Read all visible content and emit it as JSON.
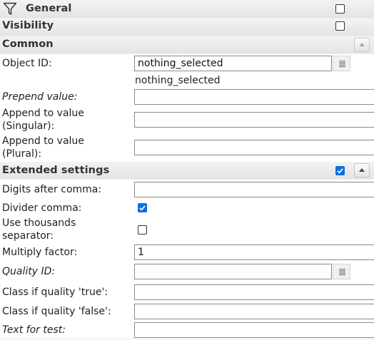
{
  "sections": {
    "general": {
      "title": "General",
      "checked": false
    },
    "visibility": {
      "title": "Visibility",
      "checked": false
    },
    "common": {
      "title": "Common"
    },
    "extended": {
      "title": "Extended settings",
      "checked": true
    }
  },
  "fields": {
    "object_id": {
      "label": "Object ID:",
      "value": "nothing_selected",
      "note": "nothing_selected"
    },
    "prepend_value": {
      "label": "Prepend value:",
      "value": ""
    },
    "append_singular": {
      "label_line1": "Append to value",
      "label_line2": "(Singular):",
      "value": ""
    },
    "append_plural": {
      "label_line1": "Append to value",
      "label_line2": "(Plural):",
      "value": ""
    },
    "digits_after_comma": {
      "label": "Digits after comma:",
      "value": ""
    },
    "divider_comma": {
      "label": "Divider comma:",
      "checked": true
    },
    "thousands_separator": {
      "label_line1": "Use thousands",
      "label_line2": "separator:",
      "checked": false
    },
    "multiply_factor": {
      "label": "Multiply factor:",
      "value": "1"
    },
    "quality_id": {
      "label": "Quality ID:",
      "value": ""
    },
    "class_quality_true": {
      "label": "Class if quality 'true':",
      "value": ""
    },
    "class_quality_false": {
      "label": "Class if quality 'false':",
      "value": ""
    },
    "text_for_test": {
      "label": "Text for test:",
      "value": ""
    }
  },
  "colors": {
    "accent": "#0b6fe0",
    "section_bg": "#e8e8e8"
  },
  "icons": [
    "filter-icon",
    "chevron-up-icon",
    "select-object-icon"
  ]
}
